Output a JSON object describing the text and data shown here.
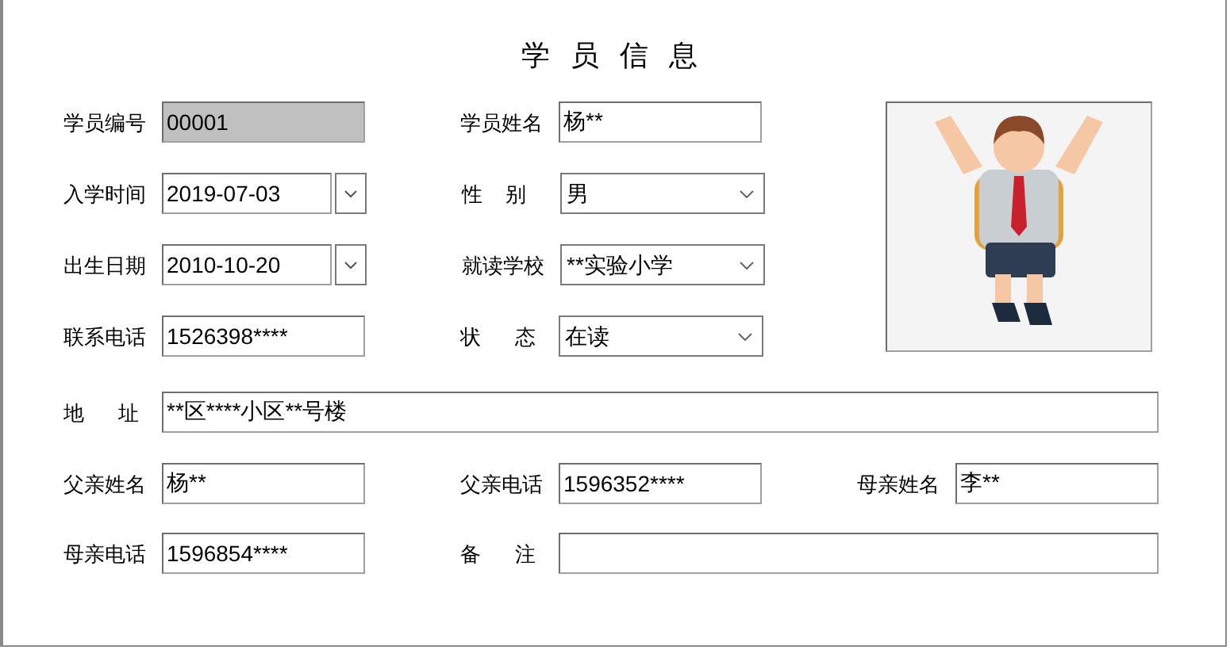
{
  "title": "学 员 信 息",
  "top_fields": [
    {
      "label": "学员编号",
      "kind": "text",
      "value": "00001",
      "disabled": true
    },
    {
      "label": "学员姓名",
      "kind": "text",
      "value": "杨**",
      "disabled": false
    },
    {
      "label": "入学时间",
      "kind": "date",
      "value": "2019-07-03",
      "disabled": false
    },
    {
      "label": "性    别",
      "kind": "select",
      "value": "男",
      "disabled": false
    },
    {
      "label": "出生日期",
      "kind": "date",
      "value": "2010-10-20",
      "disabled": false
    },
    {
      "label": "就读学校",
      "kind": "select",
      "value": "**实验小学",
      "disabled": false
    },
    {
      "label": "联系电话",
      "kind": "text",
      "value": "1526398****",
      "disabled": false
    },
    {
      "label": "状      态",
      "kind": "select",
      "value": "在读",
      "disabled": false
    }
  ],
  "address": {
    "label": "地      址",
    "value": "**区****小区**号楼"
  },
  "bottom_fields": [
    {
      "label": "父亲姓名",
      "value": "杨**"
    },
    {
      "label": "父亲电话",
      "value": "1596352****"
    },
    {
      "label": "母亲姓名",
      "value": "李**"
    },
    {
      "label": "母亲电话",
      "value": "1596854****"
    },
    {
      "label": "备      注"
    }
  ]
}
